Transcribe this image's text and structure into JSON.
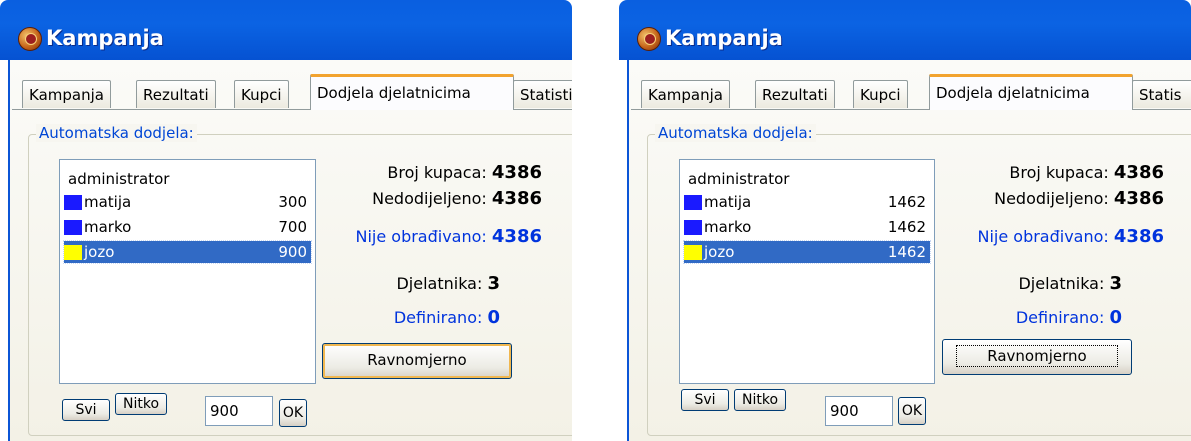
{
  "window": {
    "title": "Kampanja"
  },
  "tabs": [
    "Kampanja",
    "Rezultati",
    "Kupci",
    "Dodjela djelatnicima",
    "Statisti"
  ],
  "active_tab": "Dodjela djelatnicima",
  "group_label": "Automatska dodjela:",
  "colors": {
    "matija": "#1a1aff",
    "marko": "#1a1aff",
    "jozo": "#ffff00",
    "selection": "#316ac5",
    "tab_accent": "#f2a32e"
  },
  "panels": [
    {
      "tabs_visible": [
        "Kampanja",
        "Rezultati",
        "Kupci",
        "Dodjela djelatnicima",
        "Statisti"
      ],
      "list": {
        "header": "administrator",
        "items": [
          {
            "name": "matija",
            "value": "300",
            "color": "#1a1aff"
          },
          {
            "name": "marko",
            "value": "700",
            "color": "#1a1aff"
          },
          {
            "name": "jozo",
            "value": "900",
            "color": "#ffff00",
            "selected": true
          }
        ]
      },
      "stats": {
        "broj_label": "Broj kupaca:",
        "broj_value": "4386",
        "nedod_label": "Nedodijeljeno:",
        "nedod_value": "4386",
        "nije_label": "Nije obrađivano:",
        "nije_value": "4386",
        "djel_label": "Djelatnika:",
        "djel_value": "3",
        "def_label": "Definirano:",
        "def_value": "0"
      },
      "ravnomjerno_label": "Ravnomjerno",
      "svi_label": "Svi",
      "nitko_label": "Nitko",
      "amount_value": "900",
      "ok_label": "OK"
    },
    {
      "tabs_visible": [
        "Kampanja",
        "Rezultati",
        "Kupci",
        "Dodjela djelatnicima",
        "Statis"
      ],
      "list": {
        "header": "administrator",
        "items": [
          {
            "name": "matija",
            "value": "1462",
            "color": "#1a1aff"
          },
          {
            "name": "marko",
            "value": "1462",
            "color": "#1a1aff"
          },
          {
            "name": "jozo",
            "value": "1462",
            "color": "#ffff00",
            "selected": true
          }
        ]
      },
      "stats": {
        "broj_label": "Broj kupaca:",
        "broj_value": "4386",
        "nedod_label": "Nedodijeljeno:",
        "nedod_value": "4386",
        "nije_label": "Nije obrađivano:",
        "nije_value": "4386",
        "djel_label": "Djelatnika:",
        "djel_value": "3",
        "def_label": "Definirano:",
        "def_value": "0"
      },
      "ravnomjerno_label": "Ravnomjerno",
      "svi_label": "Svi",
      "nitko_label": "Nitko",
      "amount_value": "900",
      "ok_label": "OK"
    }
  ]
}
